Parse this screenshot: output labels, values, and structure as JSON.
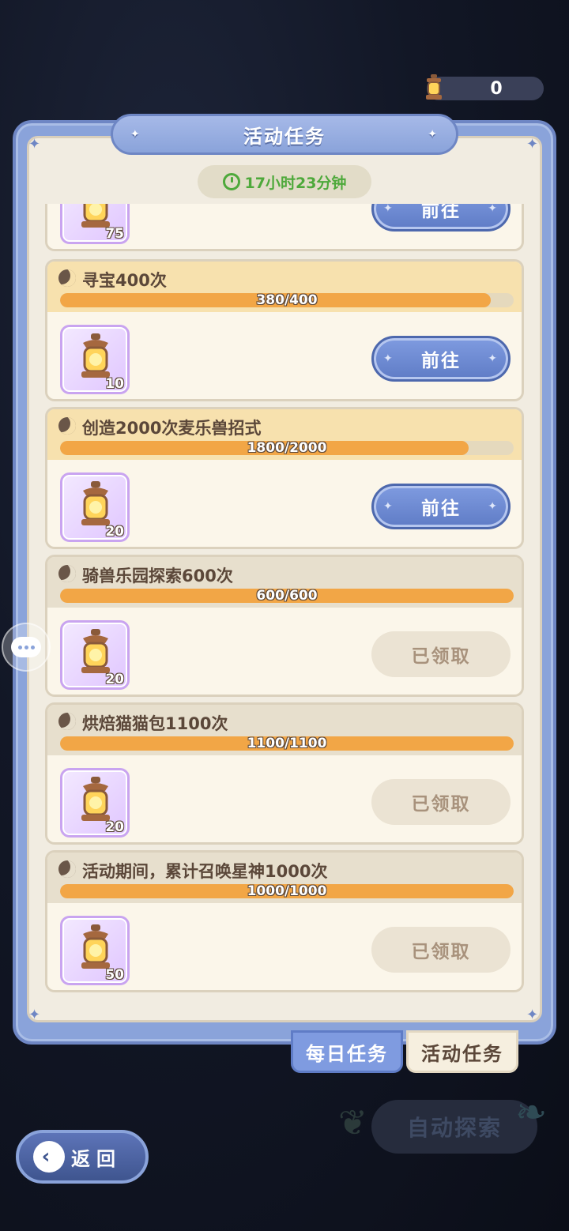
{
  "currency": {
    "icon": "lantern-icon",
    "value": "0"
  },
  "panel": {
    "title": "活动任务",
    "timer": "17小时23分钟"
  },
  "colors": {
    "accent": "#7f9be0",
    "progress": "#f2a646",
    "timer": "#4ea93b"
  },
  "partial_task": {
    "reward_count": "75",
    "button": "前往"
  },
  "tasks": [
    {
      "title": "寻宝400次",
      "progress_text": "380/400",
      "progress": 0.95,
      "reward_count": "10",
      "button": "前往",
      "status": "go"
    },
    {
      "title": "创造2000次麦乐兽招式",
      "progress_text": "1800/2000",
      "progress": 0.9,
      "reward_count": "20",
      "button": "前往",
      "status": "go"
    },
    {
      "title": "骑兽乐园探索600次",
      "progress_text": "600/600",
      "progress": 1.0,
      "reward_count": "20",
      "button": "已领取",
      "status": "done"
    },
    {
      "title": "烘焙猫猫包1100次",
      "progress_text": "1100/1100",
      "progress": 1.0,
      "reward_count": "20",
      "button": "已领取",
      "status": "done"
    },
    {
      "title": "活动期间，累计召唤星神1000次",
      "progress_text": "1000/1000",
      "progress": 1.0,
      "reward_count": "50",
      "button": "已领取",
      "status": "done"
    }
  ],
  "tabs": {
    "daily": "每日任务",
    "event": "活动任务"
  },
  "bottom": {
    "back": "返回",
    "auto_explore": "自动探索"
  }
}
